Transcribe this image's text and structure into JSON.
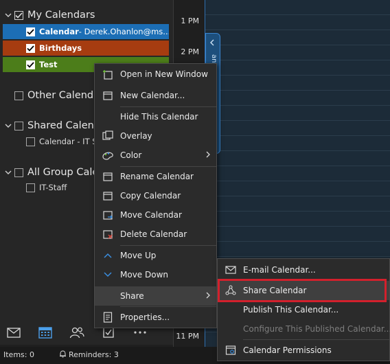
{
  "folder_pane": {
    "my_calendars": "My Calendars",
    "calendars": [
      {
        "label": "Calendar",
        "owner": " - Derek.Ohanlon@ms...",
        "color": "#1c6eb5"
      },
      {
        "label": "Birthdays",
        "color": "#a63c10"
      },
      {
        "label": "Test",
        "color": "#4c7d1a"
      }
    ],
    "other_calendars": "Other Calendars",
    "shared_calendars": "Shared Calendars",
    "shared_items": [
      "Calendar - IT Su..."
    ],
    "all_group_calendars": "All Group Calendars",
    "group_items": [
      "IT-Staff"
    ]
  },
  "time_labels": [
    "1 PM",
    "2 PM",
    "11 PM"
  ],
  "peek_text": "ant",
  "context_menu": [
    {
      "label": "Open in New Window",
      "icon": "new-window-icon"
    },
    {
      "label": "New Calendar...",
      "icon": "new-calendar-icon"
    },
    {
      "label": "Hide This Calendar",
      "icon": ""
    },
    {
      "label": "Overlay",
      "icon": "overlay-icon"
    },
    {
      "label": "Color",
      "icon": "color-icon"
    },
    {
      "label": "Rename Calendar",
      "icon": "rename-icon"
    },
    {
      "label": "Copy Calendar",
      "icon": "copy-calendar-icon"
    },
    {
      "label": "Move Calendar",
      "icon": "move-calendar-icon"
    },
    {
      "label": "Delete Calendar",
      "icon": "delete-calendar-icon"
    },
    {
      "label": "Move Up",
      "icon": "chevron-up-icon"
    },
    {
      "label": "Move Down",
      "icon": "chevron-down-icon"
    },
    {
      "label": "Share",
      "icon": ""
    },
    {
      "label": "Properties...",
      "icon": "properties-icon"
    }
  ],
  "share_submenu": [
    {
      "label": "E-mail Calendar...",
      "icon": "mail-icon"
    },
    {
      "label": "Share Calendar",
      "icon": "share-icon"
    },
    {
      "label": "Publish This Calendar...",
      "icon": ""
    },
    {
      "label": "Configure This Published Calendar...",
      "icon": ""
    },
    {
      "label": "Calendar Permissions",
      "icon": "permissions-icon"
    }
  ],
  "status_bar": {
    "items": "Items: 0",
    "reminders": "Reminders: 3"
  },
  "colors": {
    "accent": "#1c6eb5",
    "highlight_box": "#d3202c"
  }
}
